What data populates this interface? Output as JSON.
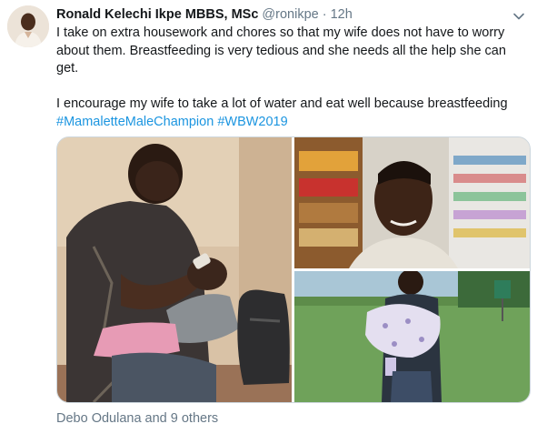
{
  "tweet": {
    "author_name": "Ronald Kelechi Ikpe MBBS, MSc",
    "handle": "@ronikpe",
    "separator": "·",
    "time": "12h",
    "lines": [
      "I take on extra housework and chores so that my wife does not have to worry",
      "about them. Breastfeeding is very tedious and she needs all the help she can",
      "get.",
      "I encourage my wife to take a lot of water and eat well because breastfeeding"
    ],
    "hashtags": [
      "#MamaletteMaleChampion",
      "#WBW2019"
    ],
    "likes_text": "Debo Odulana and 9 others"
  },
  "icons": {
    "caret": "chevron-down-icon"
  },
  "colors": {
    "link": "#1b95e0",
    "muted": "#657786",
    "text": "#14171a"
  }
}
